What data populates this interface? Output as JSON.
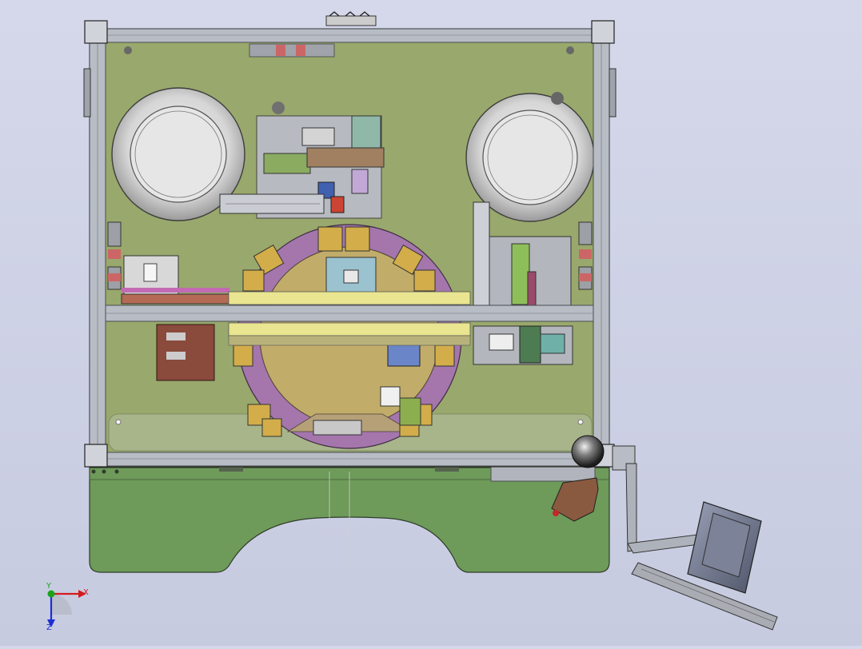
{
  "viewport": {
    "background": "#cdd1e6"
  },
  "model": {
    "plate_color": "#99a86c",
    "base_color": "#6e9a5a",
    "frame_color": "#b8bcc4",
    "turntable_color": "#a476ac",
    "bowl_color": "#bdbdbd",
    "slide_color": "#e9e590"
  },
  "triad": {
    "x_label": "X",
    "y_label": "Y",
    "z_label": "Z",
    "x_color": "#d21c1c",
    "y_color": "#1aa31a",
    "z_color": "#1c2fd2"
  }
}
